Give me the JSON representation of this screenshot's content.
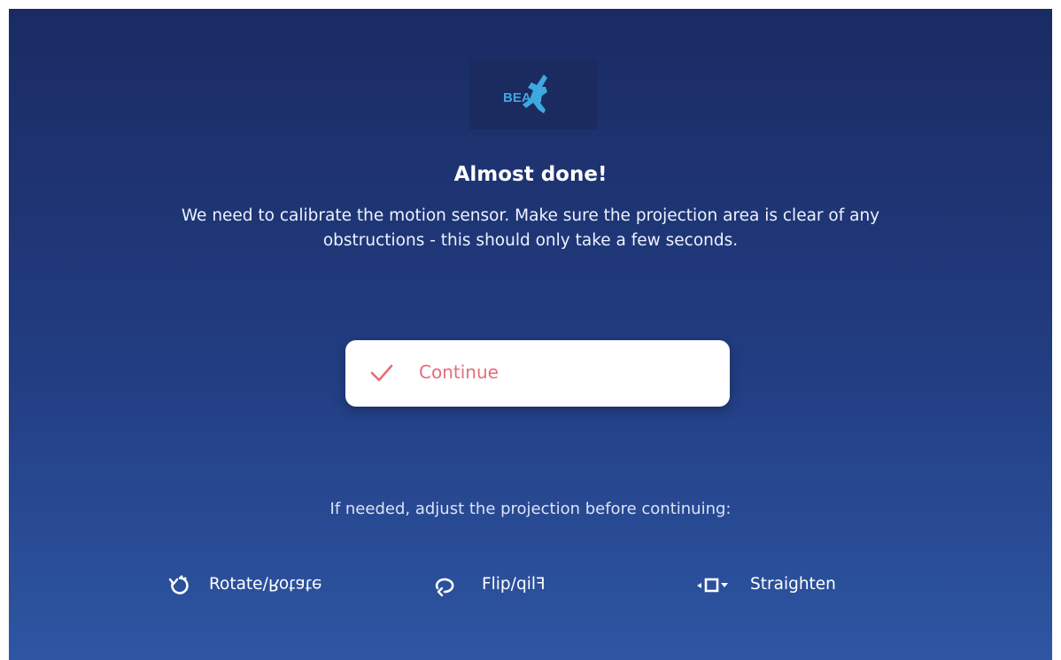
{
  "logo": {
    "text": "BEAM"
  },
  "heading": {
    "title": "Almost done!",
    "description": "We need to calibrate the motion sensor. Make sure the projection area is clear of any obstructions - this should only take a few seconds."
  },
  "continue_button": {
    "label": "Continue",
    "icon": "check-icon"
  },
  "adjust": {
    "prompt": "If needed, adjust the projection before continuing:",
    "actions": [
      {
        "label": "Rotate",
        "separator": "/",
        "mirrored": "Rotate",
        "icon": "rotate-icon"
      },
      {
        "label": "Flip",
        "separator": "/",
        "mirrored": "Flip",
        "icon": "flip-icon"
      },
      {
        "label": "Straighten",
        "icon": "straighten-icon"
      }
    ]
  },
  "colors": {
    "background_top": "#1a2b63",
    "background_bottom": "#2e56a3",
    "accent": "#e46d77",
    "logo": "#3ea8e0"
  }
}
